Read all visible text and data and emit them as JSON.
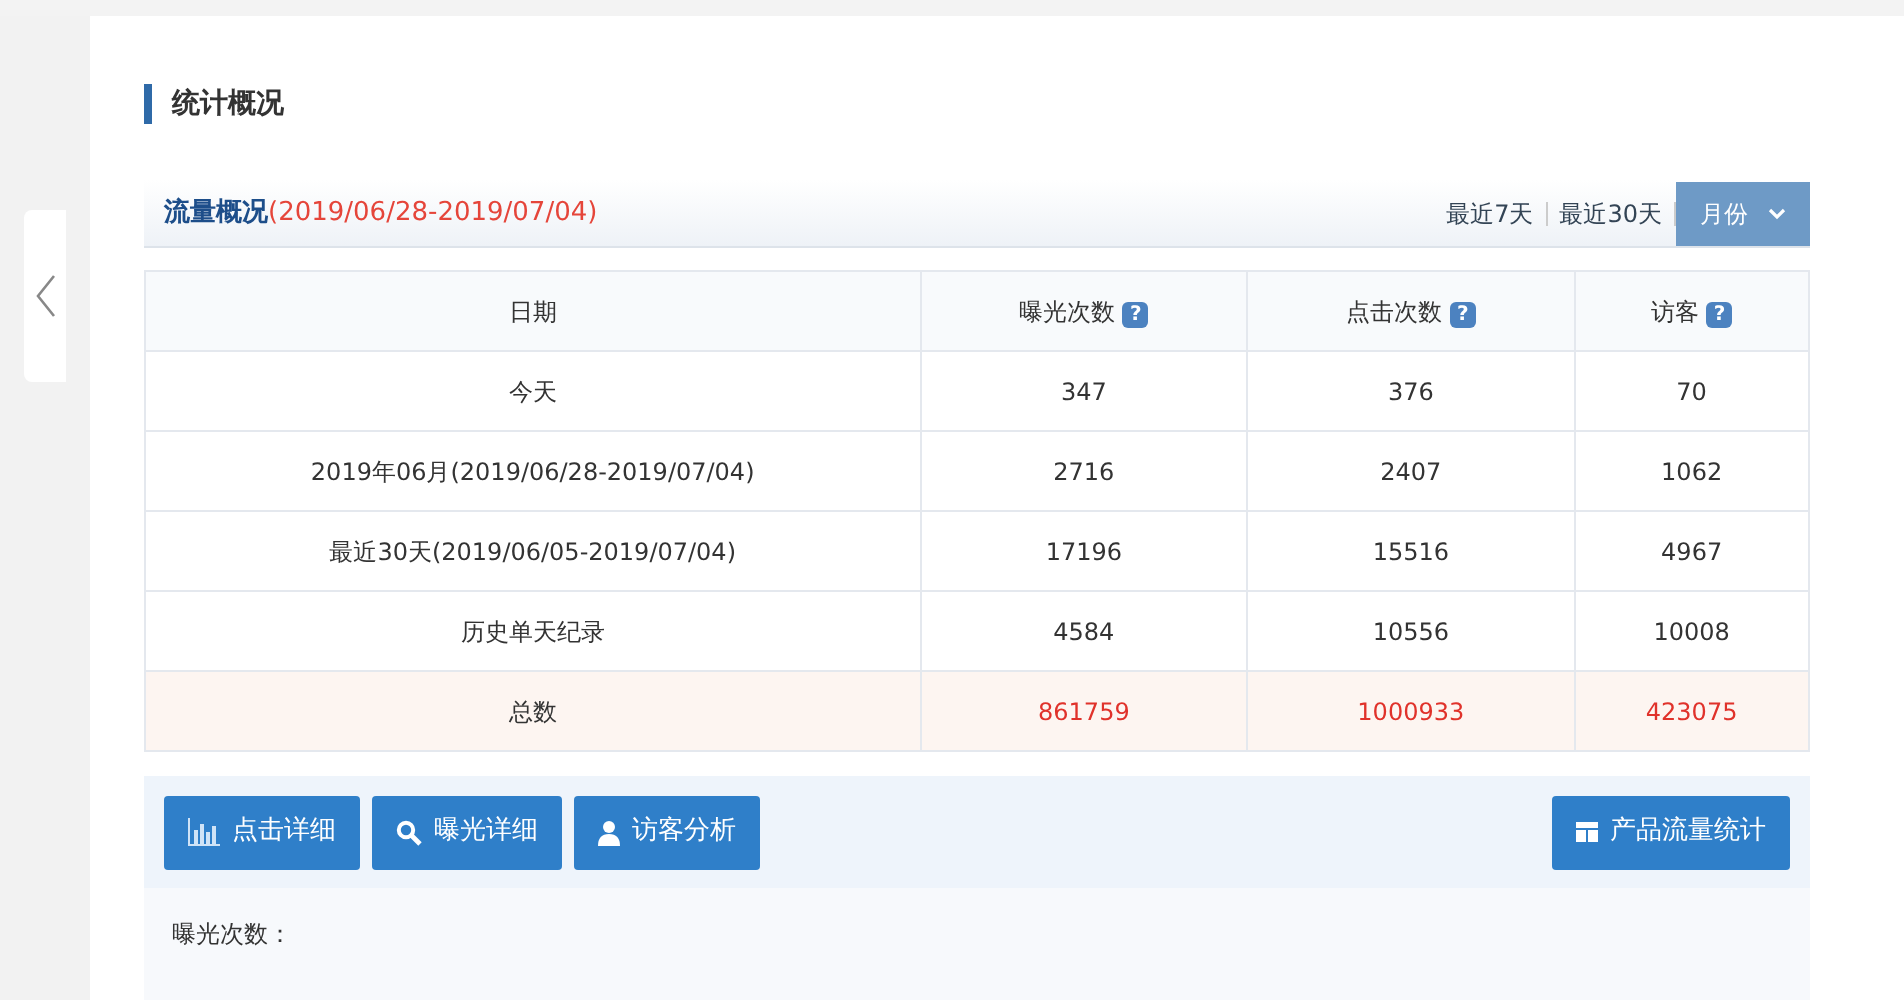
{
  "section_title": "统计概况",
  "panel": {
    "title": "流量概况",
    "date_range": "(2019/06/28-2019/07/04)",
    "range_links": [
      {
        "label": "最近7天"
      },
      {
        "label": "最近30天"
      }
    ],
    "month_dropdown": {
      "label": "月份"
    }
  },
  "table": {
    "columns": [
      {
        "label": "日期"
      },
      {
        "label": "曝光次数",
        "help": "?"
      },
      {
        "label": "点击次数",
        "help": "?"
      },
      {
        "label": "访客",
        "help": "?"
      }
    ],
    "rows": [
      {
        "kind": "normal",
        "cells": [
          "今天",
          "347",
          "376",
          "70"
        ]
      },
      {
        "kind": "normal",
        "cells": [
          "2019年06月(2019/06/28-2019/07/04)",
          "2716",
          "2407",
          "1062"
        ]
      },
      {
        "kind": "normal",
        "cells": [
          "最近30天(2019/06/05-2019/07/04)",
          "17196",
          "15516",
          "4967"
        ]
      },
      {
        "kind": "normal",
        "cells": [
          "历史单天纪录",
          "4584",
          "10556",
          "10008"
        ]
      },
      {
        "kind": "total",
        "cells": [
          "总数",
          "861759",
          "1000933",
          "423075"
        ]
      }
    ]
  },
  "toolbar": {
    "buttons": [
      {
        "label": "点击详细",
        "kind": "chart"
      },
      {
        "label": "曝光详细",
        "kind": "search"
      },
      {
        "label": "访客分析",
        "kind": "user"
      }
    ],
    "right_button": {
      "label": "产品流量统计",
      "kind": "table"
    }
  },
  "detail_label": "曝光次数："
}
